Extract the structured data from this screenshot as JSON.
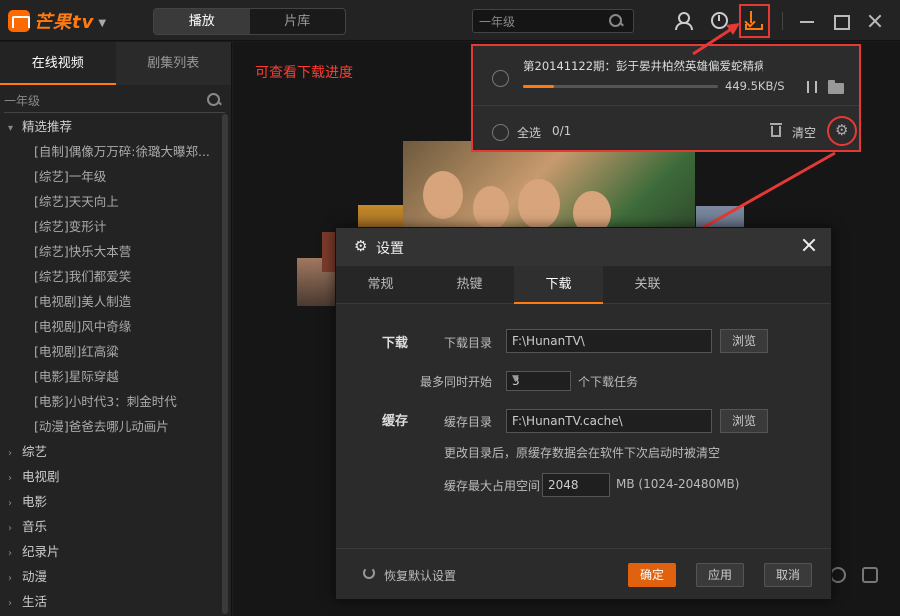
{
  "app": {
    "logo_text": "芒果tv"
  },
  "header": {
    "modes": [
      {
        "label": "播放",
        "active": true
      },
      {
        "label": "片库",
        "active": false
      }
    ],
    "search": {
      "value": "一年级"
    },
    "download_tooltip": "下载"
  },
  "sidebar": {
    "tabs": [
      {
        "label": "在线视频",
        "active": true
      },
      {
        "label": "剧集列表",
        "active": false
      }
    ],
    "search": {
      "value": "一年级"
    },
    "items": [
      {
        "label": "精选推荐",
        "type": "group",
        "expanded": true
      },
      {
        "label": "[自制]偶像万万碎:徐璐大曝郑...",
        "type": "child"
      },
      {
        "label": "[综艺]一年级",
        "type": "child"
      },
      {
        "label": "[综艺]天天向上",
        "type": "child"
      },
      {
        "label": "[综艺]变形计",
        "type": "child"
      },
      {
        "label": "[综艺]快乐大本营",
        "type": "child"
      },
      {
        "label": "[综艺]我们都爱笑",
        "type": "child"
      },
      {
        "label": "[电视剧]美人制造",
        "type": "child"
      },
      {
        "label": "[电视剧]风中奇缘",
        "type": "child"
      },
      {
        "label": "[电视剧]红高粱",
        "type": "child"
      },
      {
        "label": "[电影]星际穿越",
        "type": "child"
      },
      {
        "label": "[电影]小时代3：刺金时代",
        "type": "child"
      },
      {
        "label": "[动漫]爸爸去哪儿动画片",
        "type": "child"
      },
      {
        "label": "综艺",
        "type": "group",
        "expanded": false
      },
      {
        "label": "电视剧",
        "type": "group",
        "expanded": false
      },
      {
        "label": "电影",
        "type": "group",
        "expanded": false
      },
      {
        "label": "音乐",
        "type": "group",
        "expanded": false
      },
      {
        "label": "纪录片",
        "type": "group",
        "expanded": false
      },
      {
        "label": "动漫",
        "type": "group",
        "expanded": false
      },
      {
        "label": "生活",
        "type": "group",
        "expanded": false
      }
    ]
  },
  "annotation": "可查看下载进度",
  "download_panel": {
    "task": {
      "title": "第20141122期：彭于晏井柏然英雄偏爱蛇精病",
      "speed": "449.5KB/S",
      "progress": 0.16
    },
    "select_all_label": "全选",
    "count": "0/1",
    "clear_label": "清空"
  },
  "settings": {
    "title": "设置",
    "tabs": [
      {
        "label": "常规",
        "active": false
      },
      {
        "label": "热键",
        "active": false
      },
      {
        "label": "下载",
        "active": true
      },
      {
        "label": "关联",
        "active": false
      }
    ],
    "download": {
      "section_title": "下载",
      "dir_label": "下载目录",
      "dir_value": "F:\\HunanTV\\",
      "browse_label": "浏览",
      "concurrent_label": "最多同时开始",
      "concurrent_value": "3",
      "concurrent_suffix": "个下载任务"
    },
    "cache": {
      "section_title": "缓存",
      "dir_label": "缓存目录",
      "dir_value": "F:\\HunanTV.cache\\",
      "browse_label": "浏览",
      "note": "更改目录后，原缓存数据会在软件下次启动时被清空",
      "max_label": "缓存最大占用空间",
      "max_value": "2048",
      "max_suffix": "MB (1024-20480MB)"
    },
    "footer": {
      "restore_label": "恢复默认设置",
      "ok_label": "确定",
      "apply_label": "应用",
      "cancel_label": "取消"
    }
  },
  "colors": {
    "accent": "#ff7a10",
    "annotation_red": "#e53935"
  }
}
